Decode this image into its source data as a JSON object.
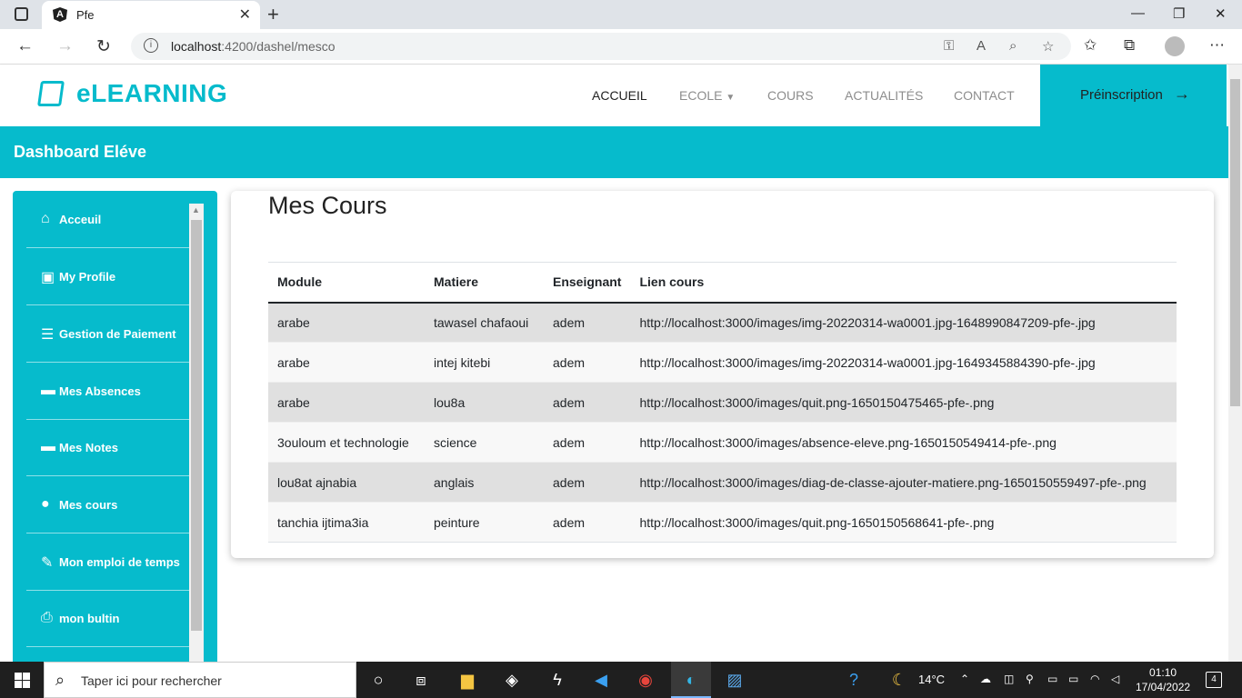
{
  "browser": {
    "tab_title": "Pfe",
    "tab_favicon": "A",
    "url_host": "localhost",
    "url_rest": ":4200/dashel/mesco"
  },
  "site": {
    "logo": "eLEARNING",
    "nav": [
      {
        "label": "ACCUEIL",
        "active": true
      },
      {
        "label": "ECOLE",
        "has_dropdown": true
      },
      {
        "label": "COURS"
      },
      {
        "label": "ACTUALITÉS"
      },
      {
        "label": "CONTACT"
      }
    ],
    "cta": "Préinscription",
    "accent_color": "#06bbcc"
  },
  "dashboard_title": "Dashboard Eléve",
  "sidebar": {
    "items": [
      {
        "label": "Acceuil",
        "icon": "home-icon"
      },
      {
        "label": "My Profile",
        "icon": "profile-card-icon"
      },
      {
        "label": "Gestion de Paiement",
        "icon": "menu-lines-icon"
      },
      {
        "label": "Mes Absences",
        "icon": "bed-icon"
      },
      {
        "label": "Mes Notes",
        "icon": "bed-icon"
      },
      {
        "label": "Mes cours",
        "icon": "person-icon"
      },
      {
        "label": "Mon emploi de temps",
        "icon": "pencil-icon"
      },
      {
        "label": "mon bultin",
        "icon": "printer-icon"
      }
    ]
  },
  "main": {
    "title": "Mes Cours",
    "columns": [
      "Module",
      "Matiere",
      "Enseignant",
      "Lien cours"
    ],
    "rows": [
      [
        "arabe",
        "tawasel chafaoui",
        "adem",
        "http://localhost:3000/images/img-20220314-wa0001.jpg-1648990847209-pfe-.jpg"
      ],
      [
        "arabe",
        "intej kitebi",
        "adem",
        "http://localhost:3000/images/img-20220314-wa0001.jpg-1649345884390-pfe-.jpg"
      ],
      [
        "arabe",
        "lou8a",
        "adem",
        "http://localhost:3000/images/quit.png-1650150475465-pfe-.png"
      ],
      [
        "3ouloum et technologie",
        "science",
        "adem",
        "http://localhost:3000/images/absence-eleve.png-1650150549414-pfe-.png"
      ],
      [
        "lou8at ajnabia",
        "anglais",
        "adem",
        "http://localhost:3000/images/diag-de-classe-ajouter-matiere.png-1650150559497-pfe-.png"
      ],
      [
        "tanchia ijtima3ia",
        "peinture",
        "adem",
        "http://localhost:3000/images/quit.png-1650150568641-pfe-.png"
      ]
    ]
  },
  "taskbar": {
    "search_placeholder": "Taper ici pour rechercher",
    "temperature": "14°C",
    "time": "01:10",
    "date": "17/04/2022",
    "notifications": "4"
  }
}
